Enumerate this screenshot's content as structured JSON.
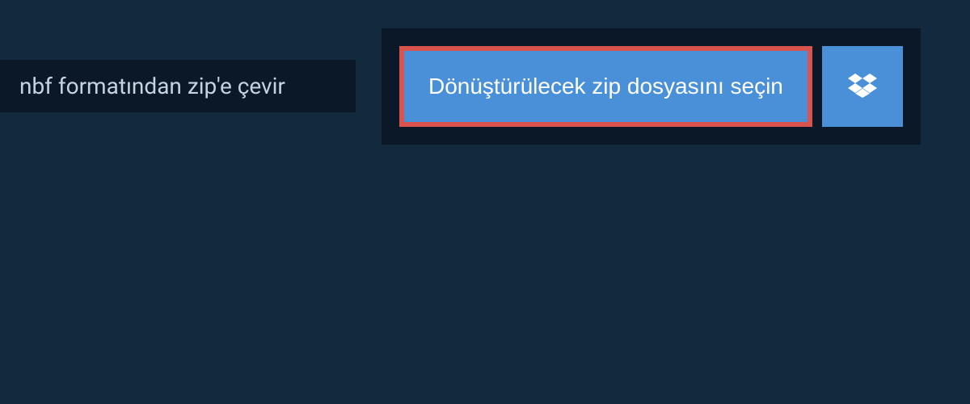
{
  "header": {
    "title": "nbf formatından zip'e çevir"
  },
  "converter": {
    "select_file_label": "Dönüştürülecek zip dosyasını seçin"
  },
  "colors": {
    "background": "#13293d",
    "panel": "#0a1828",
    "button_bg": "#4a90d9",
    "button_border": "#d9534f",
    "text_light": "#c5d3e0"
  }
}
